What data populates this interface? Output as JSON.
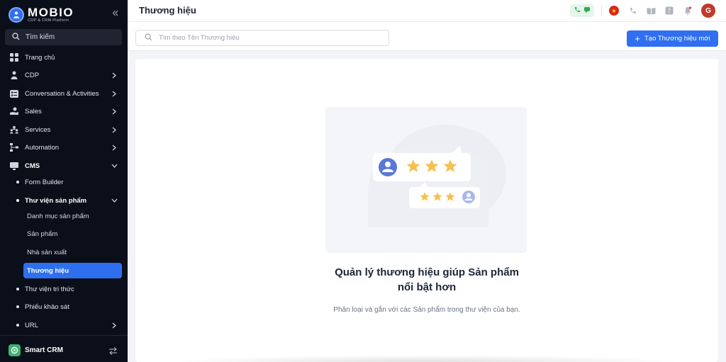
{
  "sidebar": {
    "logo": {
      "name": "MOBIO",
      "subtitle": "CDP & CRM Platform"
    },
    "search_label": "Tìm kiếm",
    "menu": [
      {
        "label": "Trang chủ",
        "icon": "home-grid-icon"
      },
      {
        "label": "CDP",
        "icon": "person-icon"
      },
      {
        "label": "Conversation & Activities",
        "icon": "checklist-icon"
      },
      {
        "label": "Sales",
        "icon": "sales-hand-icon"
      },
      {
        "label": "Services",
        "icon": "services-people-icon"
      },
      {
        "label": "Automation",
        "icon": "flow-icon"
      },
      {
        "label": "CMS",
        "icon": "monitor-icon"
      }
    ],
    "cms_children": {
      "form_builder": "Form Builder",
      "product_library": "Thư viện sản phẩm",
      "product_library_children": [
        "Danh mục sản phẩm",
        "Sản phẩm",
        "Nhà sản xuất",
        "Thương hiệu"
      ],
      "knowledge_library": "Thư viện tri thức",
      "survey": "Phiếu khảo sát",
      "url": "URL"
    },
    "footer": {
      "label": "Smart CRM"
    }
  },
  "header": {
    "title": "Thương hiệu",
    "avatar_initial": "G"
  },
  "toolbar": {
    "search_placeholder": "Tìm theo Tên Thương hiệu",
    "create_label": "Tạo Thương hiệu mới"
  },
  "empty_state": {
    "title_line1": "Quản lý thương hiệu giúp Sản phẩm",
    "title_line2": "nổi bật hơn",
    "description": "Phân loại và gắn với các Sản phẩm trong thư viện của bạn."
  },
  "colors": {
    "accent": "#2f6ff0",
    "sidebar_bg": "#0b0f19",
    "star": "#f4c04e",
    "avatar": "#c0392b"
  }
}
